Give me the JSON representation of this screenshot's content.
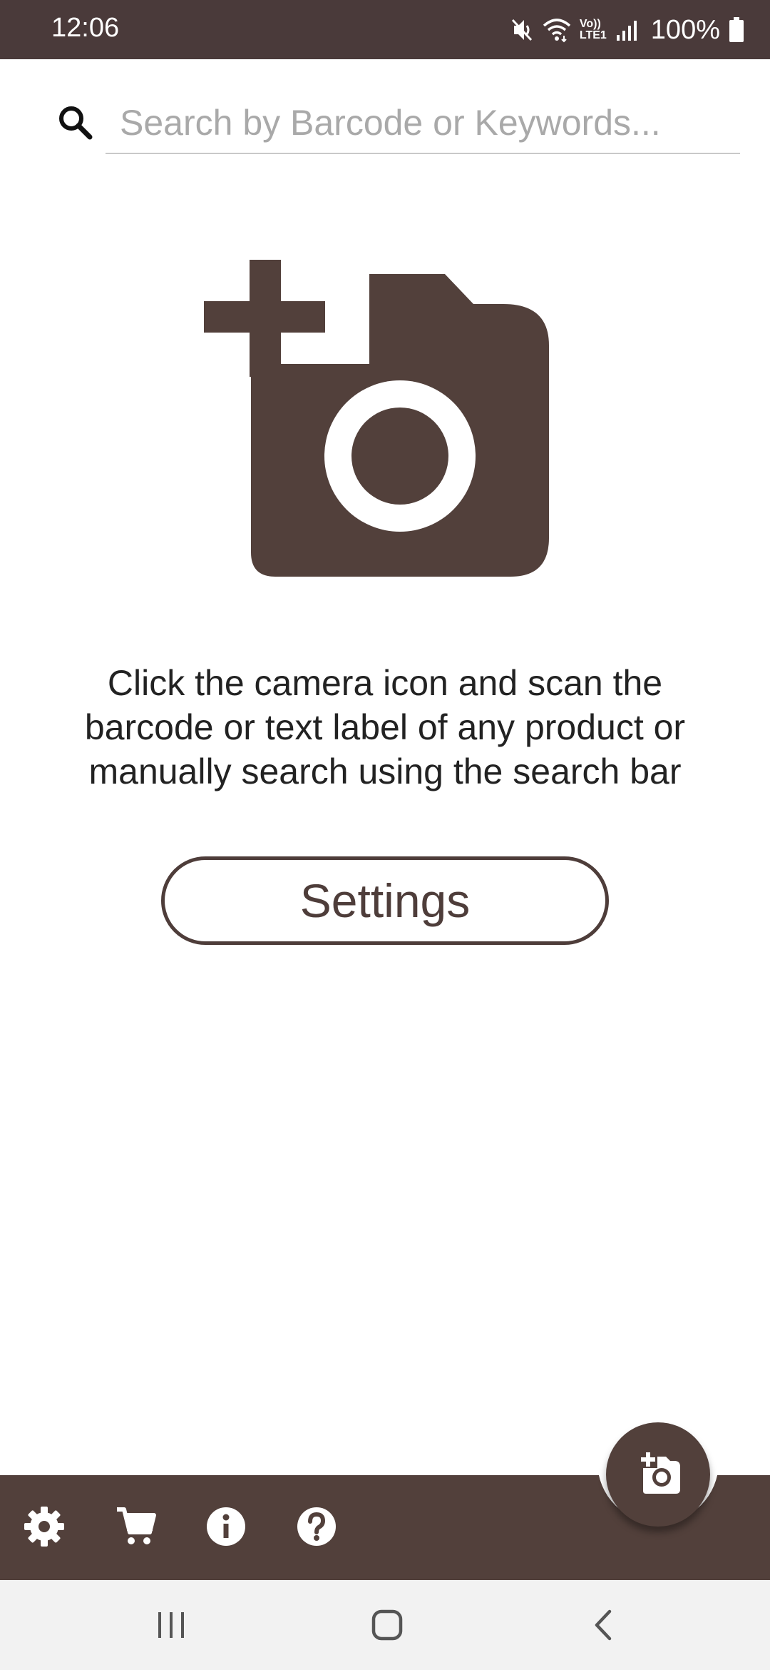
{
  "status_bar": {
    "time": "12:06",
    "battery_percent": "100%",
    "icons": [
      "mute-icon",
      "wifi-icon",
      "volte-icon",
      "signal-icon",
      "battery-icon"
    ],
    "network_label_top": "Vo))",
    "network_label_bottom": "LTE1"
  },
  "search": {
    "placeholder": "Search by Barcode or Keywords...",
    "value": "",
    "icon": "search-icon"
  },
  "hero": {
    "icon": "add-camera-icon"
  },
  "instructions": {
    "text": "Click the camera icon and scan the barcode or text label of any product or manually search using the search bar"
  },
  "settings_button": {
    "label": "Settings"
  },
  "bottom_bar": {
    "items": [
      {
        "icon": "gear-icon"
      },
      {
        "icon": "cart-icon"
      },
      {
        "icon": "info-icon"
      },
      {
        "icon": "help-icon"
      }
    ],
    "fab_icon": "add-camera-icon"
  },
  "nav_bar": {
    "buttons": [
      "recents-icon",
      "home-icon",
      "back-icon"
    ]
  },
  "colors": {
    "brand_brown": "#52403b",
    "status_bar": "#4a3a3a",
    "text": "#222222",
    "placeholder": "#a9a9a9"
  }
}
